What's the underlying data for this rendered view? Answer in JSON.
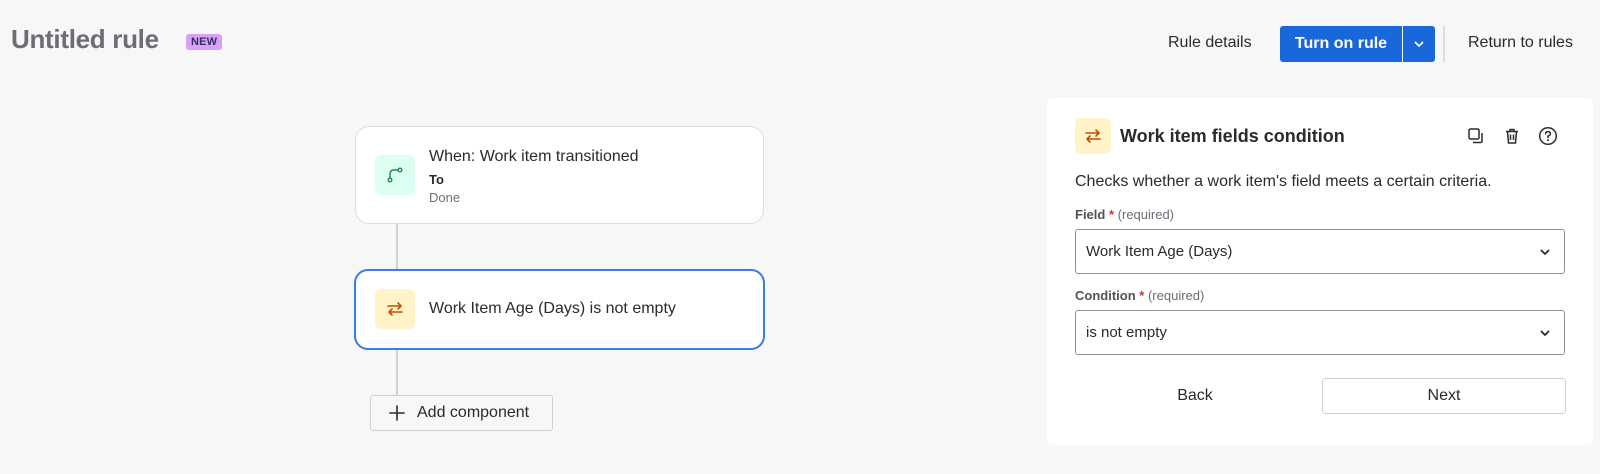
{
  "header": {
    "title": "Untitled rule",
    "badge": "NEW",
    "rule_details_label": "Rule details",
    "turn_on_label": "Turn on rule",
    "return_label": "Return to rules"
  },
  "flow": {
    "trigger": {
      "title": "When: Work item transitioned",
      "sub_label": "To",
      "sub_value": "Done",
      "icon": "branch-icon"
    },
    "condition": {
      "title": "Work Item Age (Days) is not empty",
      "icon": "swap-arrows-icon"
    },
    "add_component_label": "Add component"
  },
  "panel": {
    "title": "Work item fields condition",
    "description": "Checks whether a work item's field meets a certain criteria.",
    "field": {
      "label": "Field",
      "required_mark": "*",
      "required_text": "(required)",
      "value": "Work Item Age (Days)"
    },
    "condition": {
      "label": "Condition",
      "required_mark": "*",
      "required_text": "(required)",
      "value": "is not empty"
    },
    "back_label": "Back",
    "next_label": "Next",
    "tools": [
      "duplicate-icon",
      "trash-icon",
      "help-icon"
    ]
  },
  "colors": {
    "primary": "#1868db",
    "selected_border": "#357de8",
    "badge_bg": "#d8a0f7",
    "condition_icon_bg": "#fff3c7",
    "trigger_icon_bg": "#dcfff1"
  }
}
